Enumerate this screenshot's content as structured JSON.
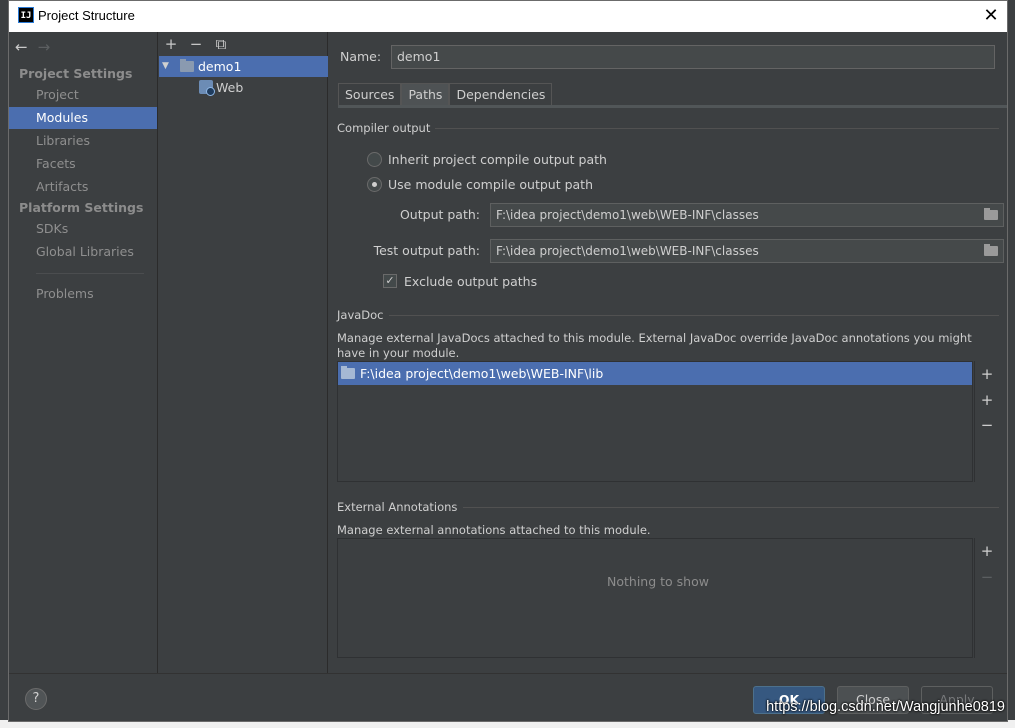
{
  "window": {
    "title": "Project Structure",
    "app_icon": "intellij-icon",
    "close_glyph": "✕"
  },
  "nav": {
    "back_glyph": "←",
    "forward_glyph": "→",
    "section_project_settings": "Project Settings",
    "section_platform_settings": "Platform Settings",
    "items": {
      "project": "Project",
      "modules": "Modules",
      "libraries": "Libraries",
      "facets": "Facets",
      "artifacts": "Artifacts",
      "sdks": "SDKs",
      "global_libraries": "Global Libraries",
      "problems": "Problems"
    },
    "selected": "Modules"
  },
  "tree": {
    "toolbar": {
      "add": "+",
      "remove": "−",
      "copy": "⧉"
    },
    "module": "demo1",
    "facet": "Web"
  },
  "main": {
    "name_label": "Name:",
    "name_value": "demo1",
    "tabs": {
      "sources": "Sources",
      "paths": "Paths",
      "dependencies": "Dependencies"
    },
    "selected_tab": "Paths",
    "compiler_output": {
      "title": "Compiler output",
      "inherit_label": "Inherit project compile output path",
      "use_module_label": "Use module compile output path",
      "selected": "use_module",
      "output_label": "Output path:",
      "output_value": "F:\\idea project\\demo1\\web\\WEB-INF\\classes",
      "test_output_label": "Test output path:",
      "test_output_value": "F:\\idea project\\demo1\\web\\WEB-INF\\classes",
      "exclude_label": "Exclude output paths",
      "exclude_checked": true,
      "checkmark": "✓"
    },
    "javadoc": {
      "title": "JavaDoc",
      "description": "Manage external JavaDocs attached to this module. External JavaDoc override JavaDoc annotations you might have in your module.",
      "items": [
        "F:\\idea project\\demo1\\web\\WEB-INF\\lib"
      ],
      "add_glyph": "+",
      "add_url_glyph": "+",
      "remove_glyph": "−"
    },
    "external_annotations": {
      "title": "External Annotations",
      "description": "Manage external annotations attached to this module.",
      "empty_text": "Nothing to show",
      "add_glyph": "+",
      "remove_glyph": "−"
    }
  },
  "footer": {
    "help_glyph": "?",
    "ok_label": "OK",
    "close_label": "Close",
    "apply_label": "Apply"
  },
  "watermark": "https://blog.csdn.net/Wangjunhe0819",
  "colors": {
    "background": "#3c3f41",
    "selection": "#4b6eaf",
    "primary_button": "#365880",
    "text": "#cfcfcf"
  }
}
